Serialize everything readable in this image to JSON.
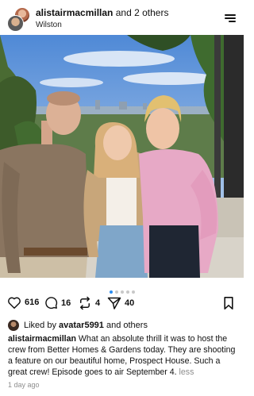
{
  "header": {
    "username": "alistairmacmillan",
    "others_text": " and 2 others",
    "location": "Wilston"
  },
  "post": {
    "carousel": {
      "count": 5,
      "active_index": 0
    }
  },
  "actions": {
    "likes": "616",
    "comments": "16",
    "reposts": "4",
    "shares": "40"
  },
  "liked_by": {
    "prefix": "Liked by ",
    "user": "avatar5991",
    "suffix": " and others"
  },
  "caption": {
    "username": "alistairmacmillan",
    "text": " What an absolute thrill it was to host the crew from Better Homes & Gardens today. They are shooting a feature on our beautiful home, Prospect House. Such a great crew! Episode goes to air September 4.",
    "more": " less"
  },
  "timestamp": "1 day ago",
  "colors": {
    "accent": "#2b8cf0",
    "muted": "#8e8e8e"
  }
}
